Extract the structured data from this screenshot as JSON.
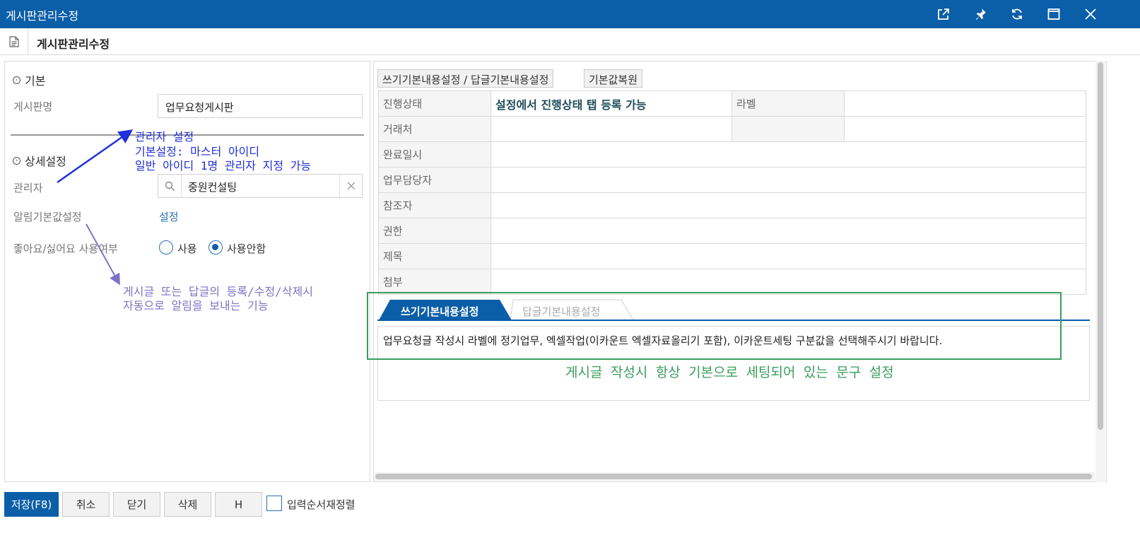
{
  "window": {
    "title": "게시판관리수정",
    "buttons": [
      "external-link",
      "pin",
      "refresh",
      "maximize",
      "close"
    ]
  },
  "header": {
    "title": "게시판관리수정"
  },
  "left": {
    "section_basic": "기본",
    "board_name_label": "게시판명",
    "board_name_value": "업무요청게시판",
    "section_detail": "상세설정",
    "admin_label": "관리자",
    "admin_value": "중원컨설팅",
    "notify_label": "알림기본값설정",
    "notify_link": "설정",
    "like_label": "좋아요/싫어요 사용여부",
    "like_options": [
      {
        "label": "사용",
        "selected": false
      },
      {
        "label": "사용안함",
        "selected": true
      }
    ]
  },
  "right": {
    "btn_settings": "쓰기기본내용설정 / 답글기본내용설정",
    "btn_restore": "기본값복원",
    "rows": [
      {
        "label": "진행상태",
        "value": "설정에서 진행상태 탭 등록 가능",
        "label2": "라벨",
        "value2": ""
      },
      {
        "label": "거래처",
        "value": "",
        "label2": "",
        "value2": ""
      },
      {
        "label": "완료일시",
        "value": ""
      },
      {
        "label": "업무담당자",
        "value": ""
      },
      {
        "label": "참조자",
        "value": ""
      },
      {
        "label": "권한",
        "value": ""
      },
      {
        "label": "제목",
        "value": ""
      },
      {
        "label": "첨부",
        "value": ""
      }
    ],
    "tabs": [
      {
        "label": "쓰기기본내용설정",
        "active": true
      },
      {
        "label": "답글기본내용설정",
        "active": false
      }
    ],
    "content_text": "업무요청글 작성시 라벨에 정기업무, 엑셀작업(이카운트 엑셀자료올리기 포함), 이카운트세팅  구분값을 선택해주시기 바랍니다."
  },
  "annotations": {
    "admin_title": "관리자 설정",
    "admin_line1": "기본설정: 마스터 아이디",
    "admin_line2": "일반 아이디 1명 관리자 지정 가능",
    "notify_line1": "게시글 또는 답글의 등록/수정/삭제시",
    "notify_line2": "자동으로 알림을 보내는 기능",
    "default_text": "게시글 작성시 항상 기본으로 세팅되어 있는 문구 설정"
  },
  "bottom": {
    "save": "저장(F8)",
    "cancel": "취소",
    "close": "닫기",
    "delete": "삭제",
    "h": "H",
    "reorder": "입력순서재정렬"
  },
  "colors": {
    "brand": "#0b5ea8",
    "annotation_blue": "#1f2fd9",
    "annotation_purple": "#7b74c6",
    "annotation_green": "#3a9d5d",
    "status_text": "#1f4e5a"
  }
}
